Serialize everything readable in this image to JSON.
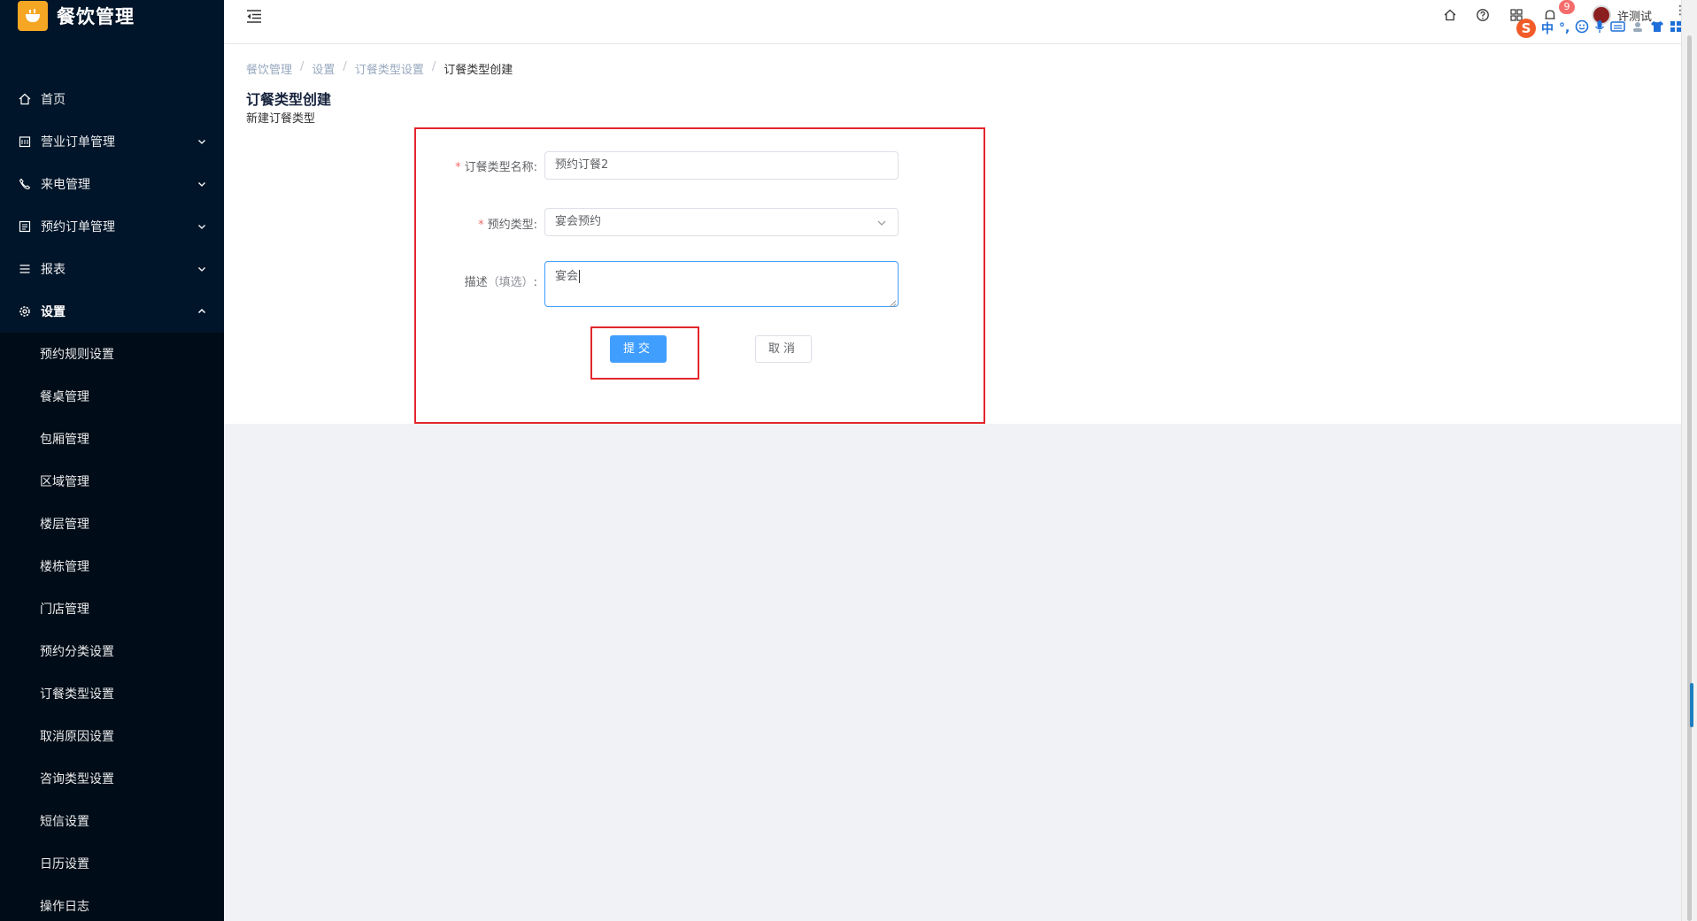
{
  "app": {
    "title": "餐饮管理"
  },
  "sidebar": {
    "items": [
      {
        "label": "首页",
        "icon": "home-icon"
      },
      {
        "label": "营业订单管理",
        "icon": "calendar-icon",
        "has_arrow": true
      },
      {
        "label": "来电管理",
        "icon": "phone-icon",
        "has_arrow": true
      },
      {
        "label": "预约订单管理",
        "icon": "list-icon",
        "has_arrow": true
      },
      {
        "label": "报表",
        "icon": "menu-icon",
        "has_arrow": true
      },
      {
        "label": "设置",
        "icon": "gear-icon",
        "has_arrow": true,
        "expanded": true
      }
    ],
    "sub_items": [
      {
        "label": "预约规则设置"
      },
      {
        "label": "餐桌管理"
      },
      {
        "label": "包厢管理"
      },
      {
        "label": "区域管理"
      },
      {
        "label": "楼层管理"
      },
      {
        "label": "楼栋管理"
      },
      {
        "label": "门店管理"
      },
      {
        "label": "预约分类设置"
      },
      {
        "label": "订餐类型设置"
      },
      {
        "label": "取消原因设置"
      },
      {
        "label": "咨询类型设置"
      },
      {
        "label": "短信设置"
      },
      {
        "label": "日历设置"
      },
      {
        "label": "操作日志"
      }
    ]
  },
  "header": {
    "notification_count": "9",
    "username": "许测试",
    "icons": [
      "home-icon",
      "help-icon",
      "grid-icon",
      "bell-icon"
    ]
  },
  "ime": {
    "label": "中",
    "punct": "°,",
    "logo": "S"
  },
  "breadcrumb": [
    "餐饮管理",
    "设置",
    "订餐类型设置",
    "订餐类型创建"
  ],
  "page": {
    "title": "订餐类型创建",
    "subtitle": "新建订餐类型"
  },
  "form": {
    "name_label": "订餐类型名称:",
    "name_value": "预约订餐2",
    "type_label": "预约类型:",
    "type_value": "宴会预约",
    "desc_label": "描述",
    "desc_optional": "（填选）",
    "desc_colon": ":",
    "desc_value": "宴会",
    "required_mark": "*",
    "submit_label": "提交",
    "cancel_label": "取消"
  },
  "colors": {
    "sidebar_bg": "#001529",
    "primary": "#409eff",
    "highlight": "#e3262d",
    "logo_bg": "#f5a623"
  }
}
